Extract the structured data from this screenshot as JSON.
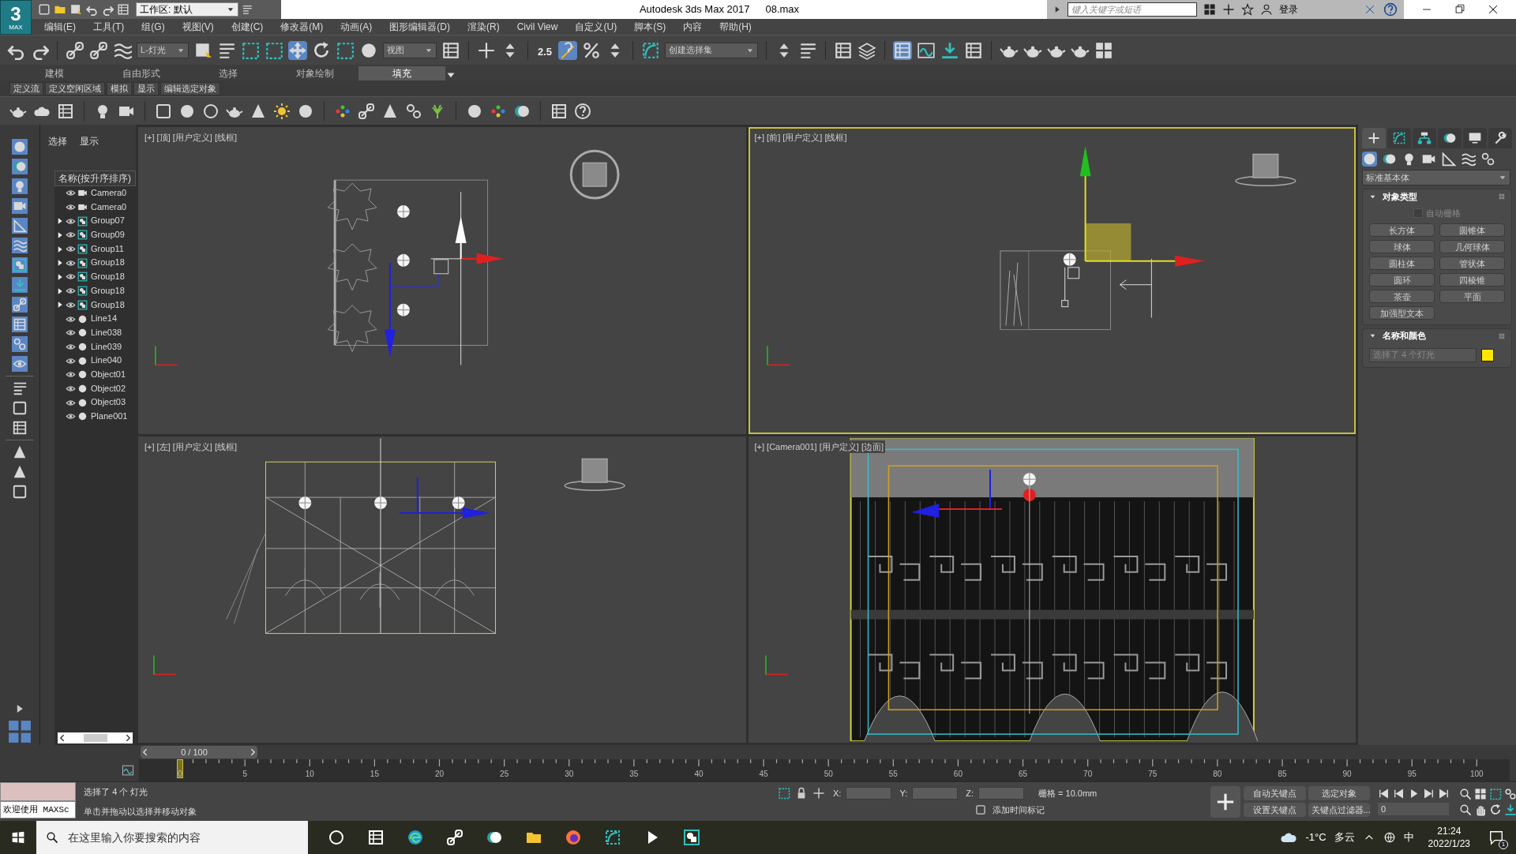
{
  "window": {
    "app_badge": "3",
    "app_badge_sub": "MAX",
    "workspace": "工作区: 默认",
    "title": "Autodesk 3ds Max 2017",
    "file": "08.max",
    "search_placeholder": "键入关键字或短语",
    "login": "登录"
  },
  "menu": [
    "编辑(E)",
    "工具(T)",
    "组(G)",
    "视图(V)",
    "创建(C)",
    "修改器(M)",
    "动画(A)",
    "图形编辑器(D)",
    "渲染(R)",
    "Civil View",
    "自定义(U)",
    "脚本(S)",
    "内容",
    "帮助(H)"
  ],
  "toolbar": {
    "selection_filter": "L-灯光",
    "reference_coord": "视图",
    "snap_label": "2.5",
    "named_selection": "创建选择集"
  },
  "ribbon": {
    "tabs": [
      {
        "label": "建模",
        "selected": false
      },
      {
        "label": "自由形式",
        "selected": false
      },
      {
        "label": "选择",
        "selected": false
      },
      {
        "label": "对象绘制",
        "selected": false
      },
      {
        "label": "填充",
        "selected": true
      }
    ],
    "subtabs": [
      "定义流",
      "定义空闲区域",
      "模拟",
      "显示",
      "编辑选定对象"
    ]
  },
  "scene_explorer": {
    "tabs": [
      "选择",
      "显示"
    ],
    "header": "名称(按升序排序)",
    "items": [
      {
        "name": "Camera0",
        "kind": "camera",
        "expandable": false
      },
      {
        "name": "Camera0",
        "kind": "camera",
        "expandable": false
      },
      {
        "name": "Group07",
        "kind": "group",
        "expandable": true
      },
      {
        "name": "Group09",
        "kind": "group",
        "expandable": true
      },
      {
        "name": "Group11",
        "kind": "group",
        "expandable": true
      },
      {
        "name": "Group18",
        "kind": "group",
        "expandable": true
      },
      {
        "name": "Group18",
        "kind": "group",
        "expandable": true
      },
      {
        "name": "Group18",
        "kind": "group",
        "expandable": true
      },
      {
        "name": "Group18",
        "kind": "group",
        "expandable": true
      },
      {
        "name": "Line14",
        "kind": "shape",
        "expandable": false
      },
      {
        "name": "Line038",
        "kind": "shape",
        "expandable": false
      },
      {
        "name": "Line039",
        "kind": "shape",
        "expandable": false
      },
      {
        "name": "Line040",
        "kind": "shape",
        "expandable": false
      },
      {
        "name": "Object01",
        "kind": "shape",
        "expandable": false
      },
      {
        "name": "Object02",
        "kind": "shape",
        "expandable": false
      },
      {
        "name": "Object03",
        "kind": "shape",
        "expandable": false
      },
      {
        "name": "Plane001",
        "kind": "shape",
        "expandable": false
      }
    ]
  },
  "viewports": [
    {
      "label": "[+] [顶] [用户定义] [线框]",
      "kind": "top",
      "active": false
    },
    {
      "label": "[+] [前] [用户定义] [线框]",
      "kind": "front",
      "active": true
    },
    {
      "label": "[+] [左] [用户定义] [线框]",
      "kind": "left",
      "active": false
    },
    {
      "label": "[+] [Camera001] [用户定义] [边面]",
      "kind": "camera",
      "active": false
    }
  ],
  "command_panel": {
    "dropdown": "标准基本体",
    "object_type": {
      "title": "对象类型",
      "autogrid": {
        "label": "自动栅格",
        "checked": false
      },
      "buttons": [
        "长方体",
        "圆锥体",
        "球体",
        "几何球体",
        "圆柱体",
        "管状体",
        "圆环",
        "四棱锥",
        "茶壶",
        "平面",
        "加强型文本"
      ]
    },
    "name_color": {
      "title": "名称和颜色",
      "value": "选择了 4 个灯光",
      "color": "#ffe600"
    }
  },
  "timeline": {
    "slider": "0 / 100",
    "ticks": [
      "0",
      "5",
      "10",
      "15",
      "20",
      "25",
      "30",
      "35",
      "40",
      "45",
      "50",
      "55",
      "60",
      "65",
      "70",
      "75",
      "80",
      "85",
      "90",
      "95",
      "100"
    ]
  },
  "status": {
    "maxscript": "欢迎使用 MAXSc",
    "prompt": "选择了 4 个 灯光",
    "hint": "单击并拖动以选择并移动对象",
    "x_label": "X:",
    "y_label": "Y:",
    "z_label": "Z:",
    "grid": "栅格 = 10.0mm",
    "add_time_tag": "添加时间标记",
    "auto_key": "自动关键点",
    "key_mode": "选定对象",
    "set_key": "设置关键点",
    "key_filters": "关键点过滤器...",
    "frame": "0"
  },
  "taskbar": {
    "search_placeholder": "在这里输入你要搜索的内容",
    "weather": "-1°C",
    "weather_text": "多云",
    "ime": "中",
    "time": "21:24",
    "date": "2022/1/23",
    "notifications": "1"
  }
}
